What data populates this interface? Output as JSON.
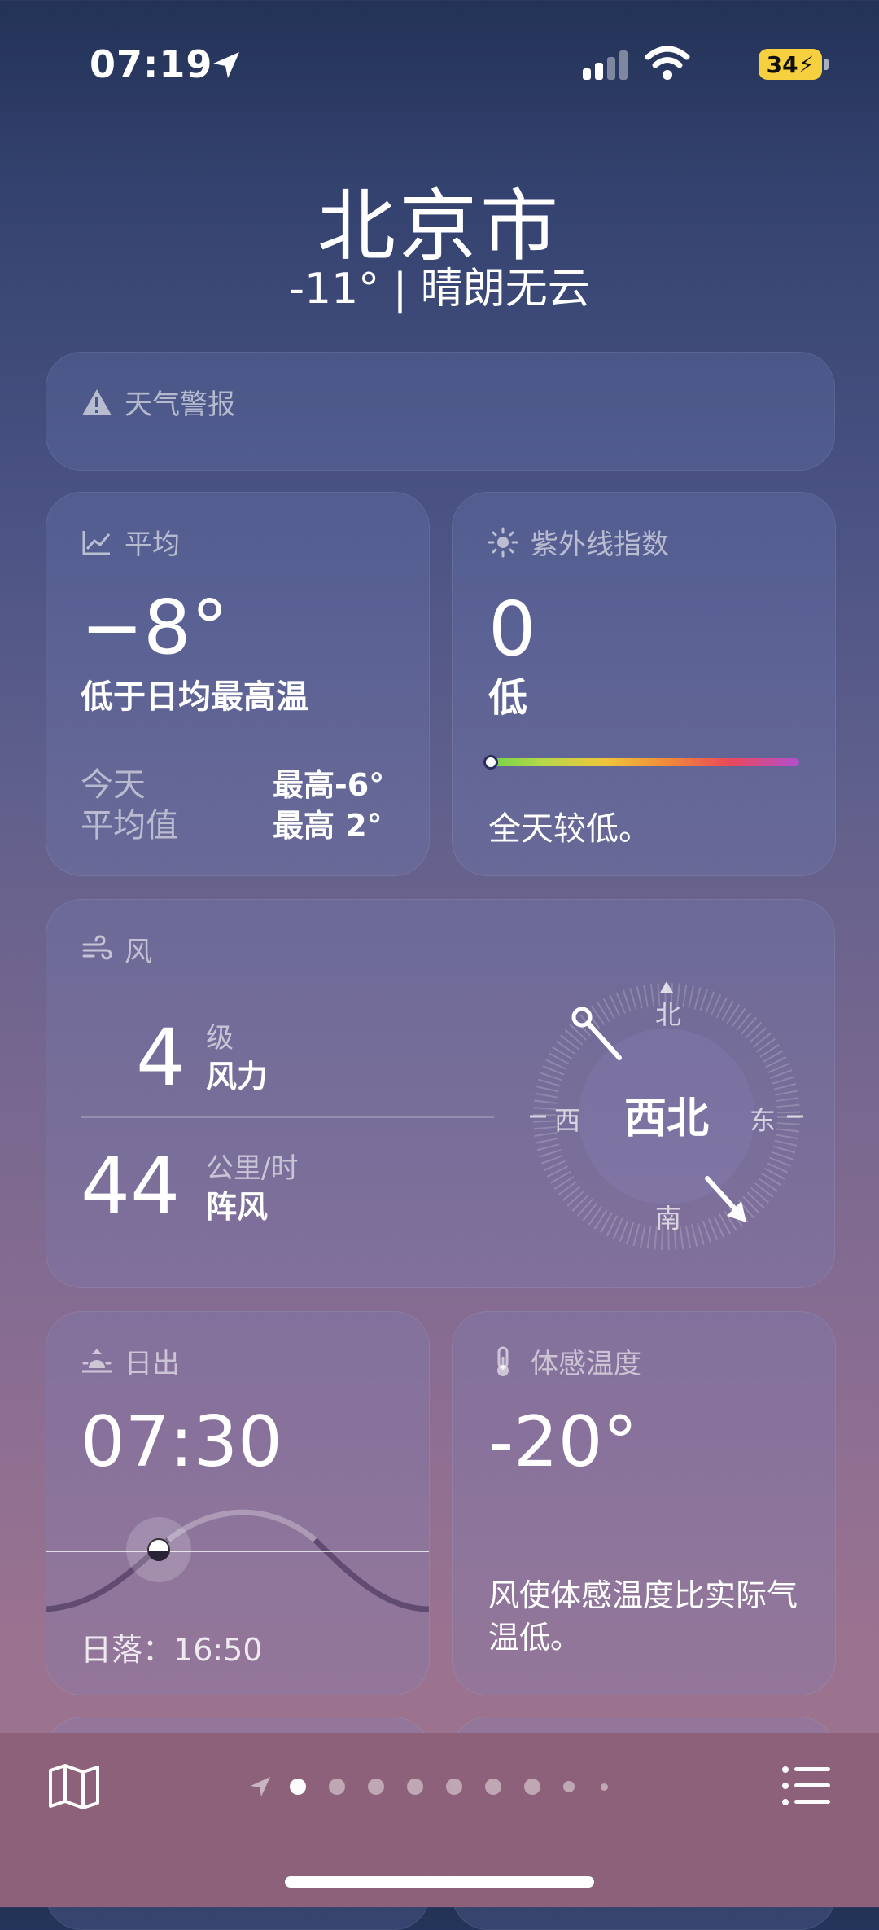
{
  "status_bar": {
    "time": "07:19",
    "battery": "34"
  },
  "header": {
    "city": "北京市",
    "summary": "-11° | 晴朗无云"
  },
  "alert": {
    "title": "天气警报"
  },
  "average": {
    "title": "平均",
    "value": "−8°",
    "subtitle": "低于日均最高温",
    "rows": [
      {
        "label": "今天",
        "value": "最高-6°"
      },
      {
        "label": "平均值",
        "value": "最高 2°"
      }
    ]
  },
  "uv": {
    "title": "紫外线指数",
    "value": "0",
    "level": "低",
    "note": "全天较低。",
    "level_fraction": 0
  },
  "wind": {
    "title": "风",
    "level": {
      "value": "4",
      "unit": "级",
      "label": "风力"
    },
    "gust": {
      "value": "44",
      "unit": "公里/时",
      "label": "阵风"
    },
    "compass": {
      "n": "北",
      "s": "南",
      "e": "东",
      "w": "西",
      "direction": "西北"
    }
  },
  "sunrise": {
    "title": "日出",
    "time": "07:30",
    "sunset_label": "日落：",
    "sunset_time": "16:50"
  },
  "feels_like": {
    "title": "体感温度",
    "value": "-20°",
    "note": "风使体感温度比实际气温低。"
  },
  "colors": {
    "accent_battery": "#f6d03f",
    "toolbar": "#8d6179"
  }
}
